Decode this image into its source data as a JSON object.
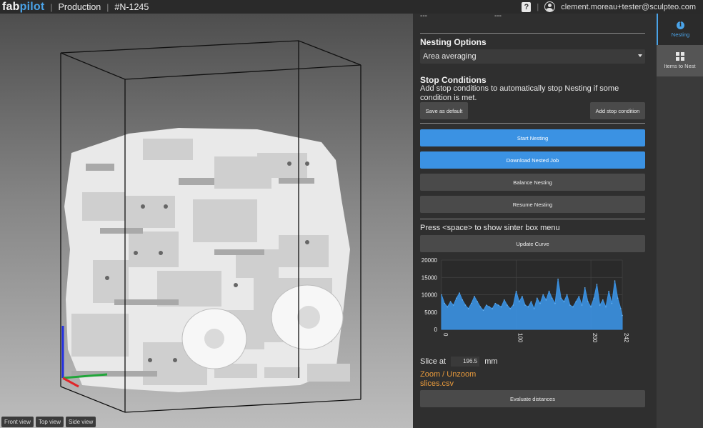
{
  "header": {
    "logo_fab": "fab",
    "logo_pilot": "pilot",
    "section": "Production",
    "job_id": "#N-1245",
    "user_email": "clement.moreau+tester@sculpteo.com",
    "help_label": "?"
  },
  "viewport": {
    "view_buttons": [
      "Front view",
      "Top view",
      "Side view"
    ],
    "axis_colors": {
      "x": "#e0262a",
      "y": "#21a63a",
      "z": "#2430e0"
    }
  },
  "panel": {
    "top_dashes": [
      "---",
      "---"
    ],
    "nesting_options": {
      "heading": "Nesting Options",
      "selected": "Area averaging"
    },
    "stop_conditions": {
      "heading": "Stop Conditions",
      "description": "Add stop conditions to automatically stop Nesting if some condition is met.",
      "save_default": "Save as default",
      "add_condition": "Add stop condition"
    },
    "actions": {
      "start": "Start Nesting",
      "download": "Download Nested Job",
      "balance": "Balance Nesting",
      "resume": "Resume Nesting"
    },
    "sinter_hint": "Press <space> to show sinter box menu",
    "update_curve": "Update Curve",
    "slice": {
      "label": "Slice at",
      "value": "196.5",
      "unit": "mm"
    },
    "zoom_link": "Zoom / Unzoom",
    "csv_link": "slices.csv",
    "evaluate": "Evaluate distances"
  },
  "chart_data": {
    "type": "area",
    "title": "",
    "xlabel": "",
    "ylabel": "",
    "xlim": [
      0,
      242
    ],
    "ylim": [
      0,
      20000
    ],
    "y_ticks": [
      0,
      5000,
      10000,
      15000,
      20000
    ],
    "x_ticks": [
      0,
      100,
      200,
      242
    ],
    "grid": true,
    "color": "#3b92e3",
    "x": [
      0,
      4,
      8,
      12,
      16,
      20,
      24,
      28,
      32,
      36,
      40,
      44,
      48,
      52,
      56,
      60,
      64,
      68,
      72,
      76,
      80,
      84,
      88,
      92,
      96,
      100,
      104,
      108,
      112,
      116,
      120,
      124,
      128,
      132,
      136,
      140,
      144,
      148,
      152,
      156,
      160,
      164,
      168,
      172,
      176,
      180,
      184,
      188,
      192,
      196,
      200,
      204,
      208,
      212,
      216,
      220,
      224,
      228,
      232,
      236,
      240,
      242
    ],
    "values": [
      10000,
      7500,
      6500,
      8000,
      7000,
      9000,
      10500,
      8500,
      7000,
      6000,
      7500,
      9500,
      8000,
      6500,
      5500,
      7000,
      6500,
      6000,
      7500,
      7000,
      6500,
      8500,
      7000,
      6000,
      7000,
      11000,
      8000,
      9500,
      7000,
      6500,
      8000,
      6000,
      9000,
      7500,
      10000,
      8500,
      11000,
      9000,
      7500,
      14500,
      9000,
      8000,
      10000,
      7000,
      6500,
      8000,
      9500,
      7000,
      12000,
      8000,
      6500,
      9000,
      13000,
      7000,
      8500,
      6500,
      11000,
      7500,
      14000,
      9000,
      6000,
      4000
    ]
  },
  "sidebar": {
    "tabs": [
      {
        "label": "Nesting",
        "icon": "info-icon"
      },
      {
        "label": "Items to Nest",
        "icon": "grid-icon"
      }
    ]
  }
}
